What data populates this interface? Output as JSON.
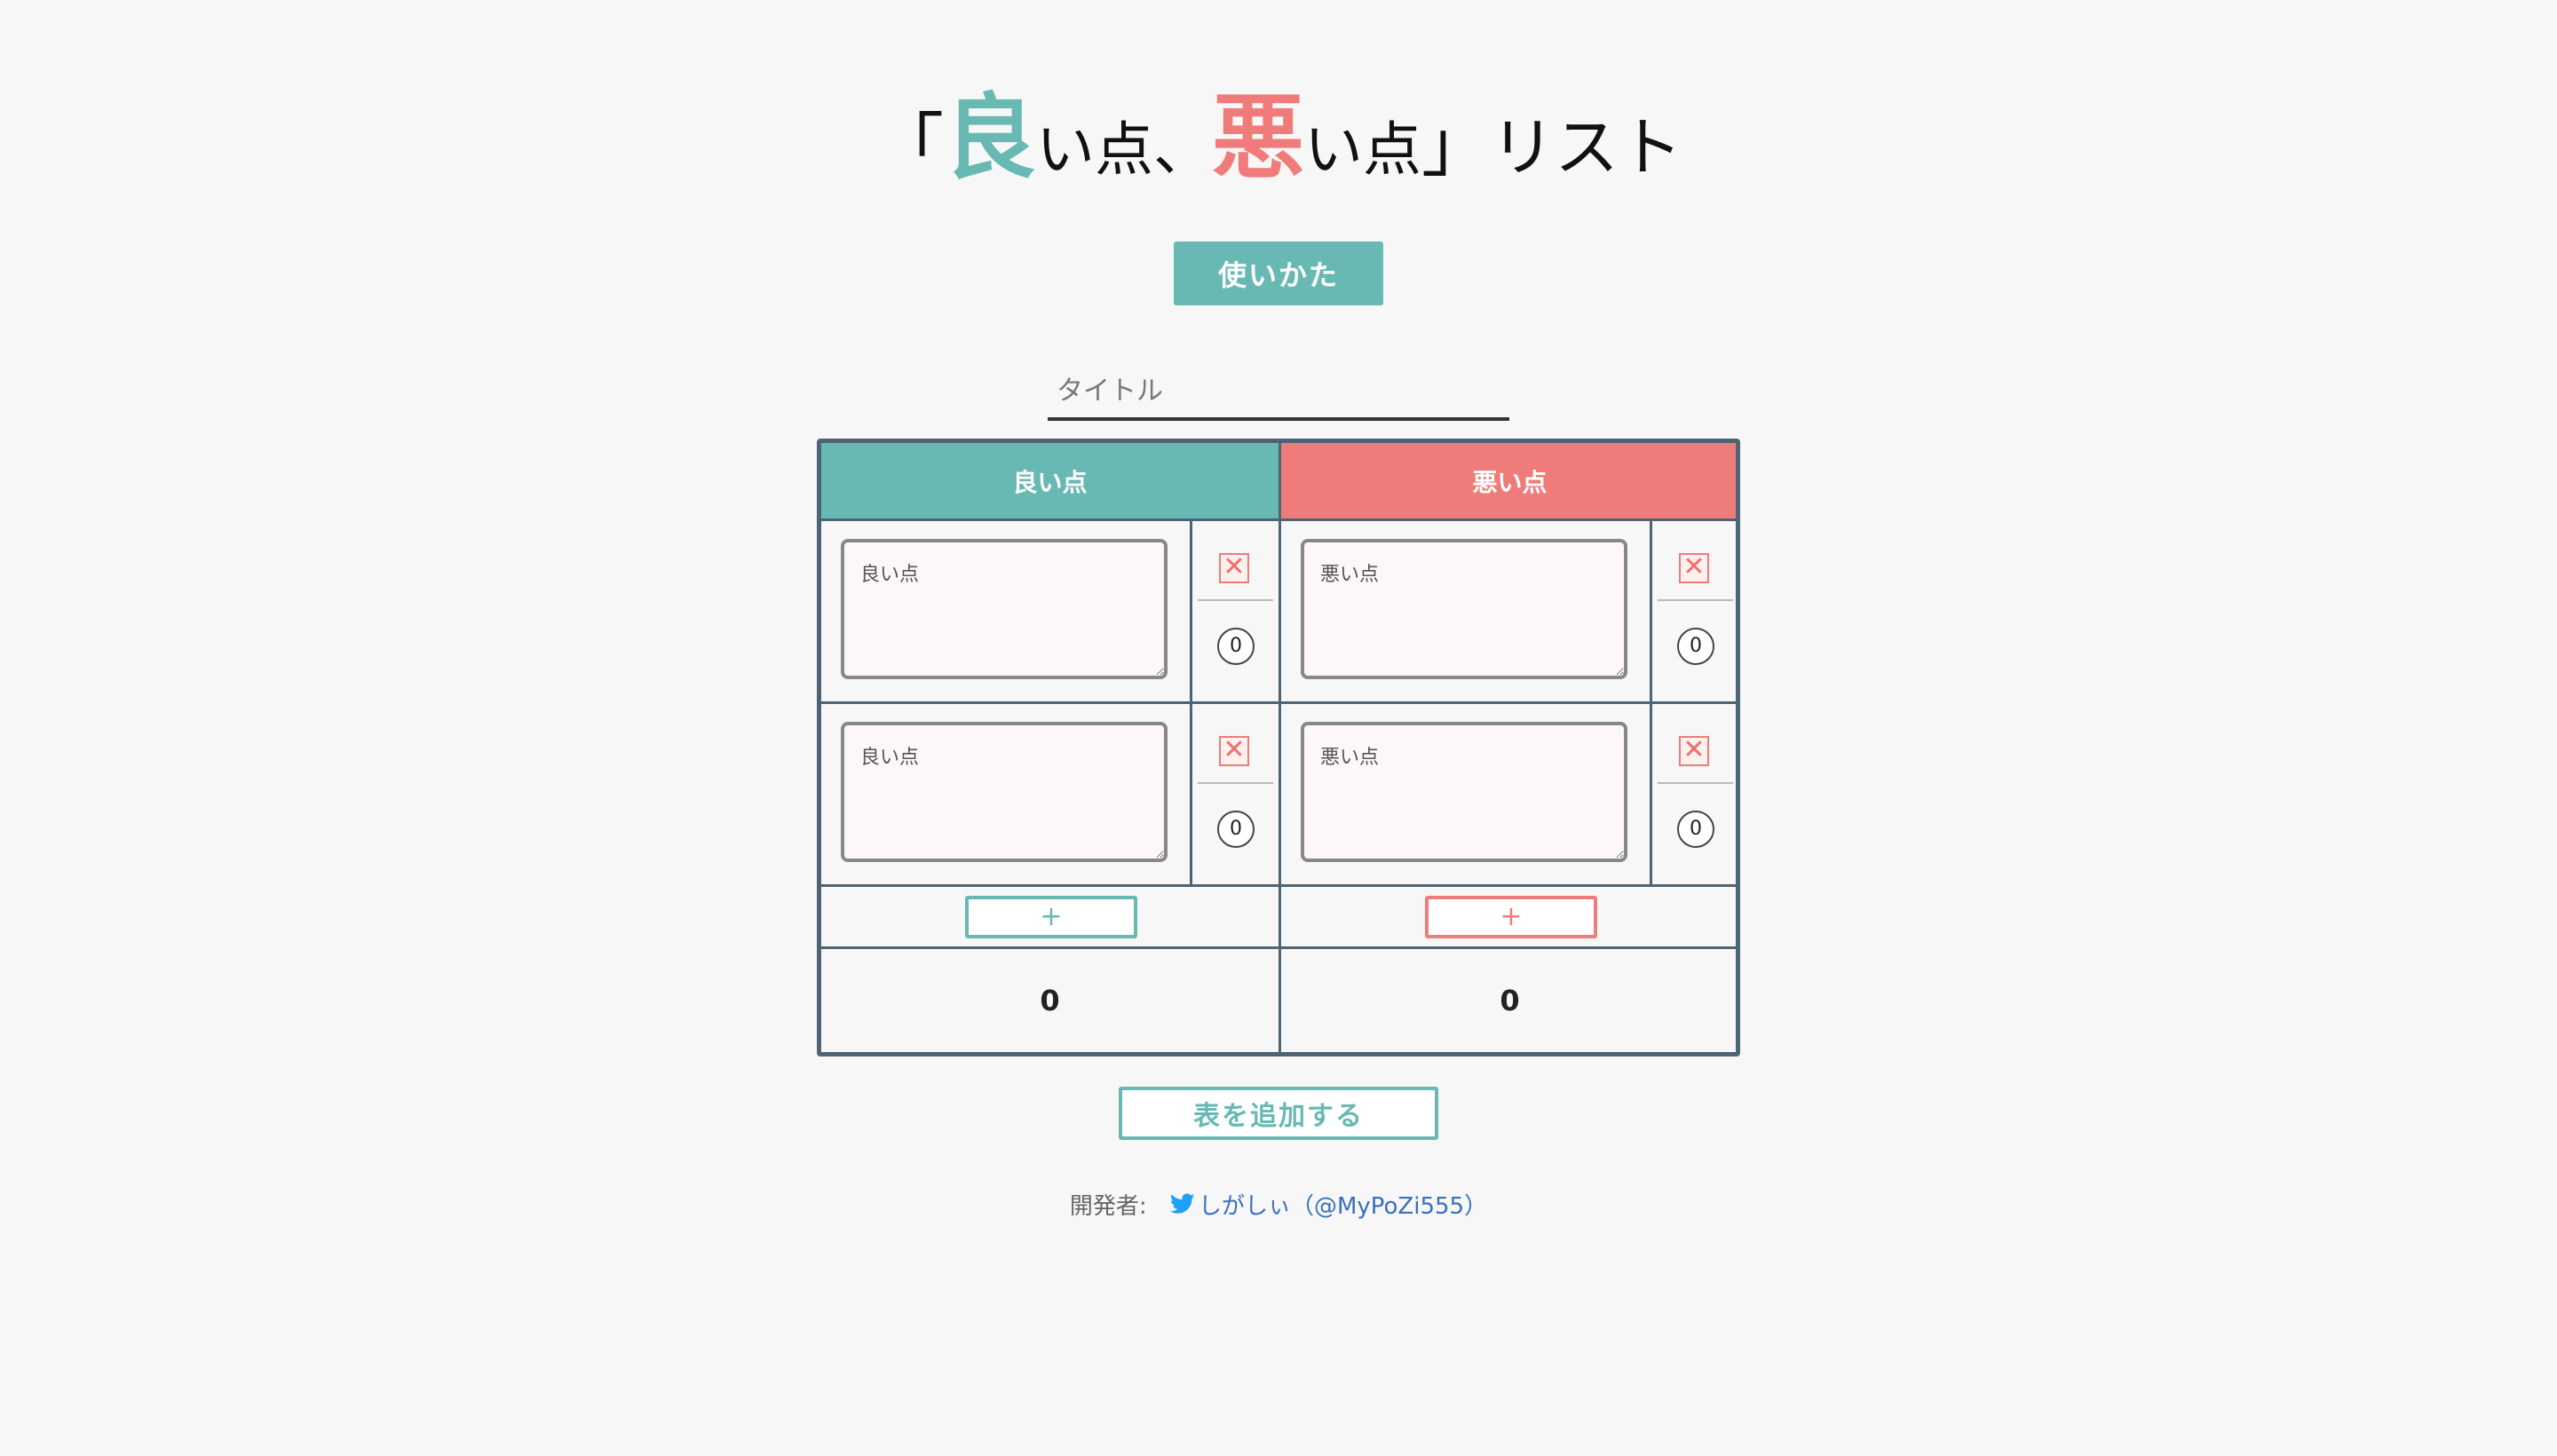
{
  "title": {
    "open_bracket": "「",
    "good_char": "良",
    "good_rest": "い点、",
    "bad_char": "悪",
    "bad_rest": "い点",
    "close_bracket": "」",
    "suffix": "リスト"
  },
  "howto_label": "使いかた",
  "title_input": {
    "placeholder": "タイトル",
    "value": ""
  },
  "columns": {
    "good": {
      "header": "良い点",
      "rows": [
        {
          "placeholder": "良い点",
          "delete": "✕",
          "count": "0"
        },
        {
          "placeholder": "良い点",
          "delete": "✕",
          "count": "0"
        }
      ],
      "add_label": "+",
      "total": "0"
    },
    "bad": {
      "header": "悪い点",
      "rows": [
        {
          "placeholder": "悪い点",
          "delete": "✕",
          "count": "0"
        },
        {
          "placeholder": "悪い点",
          "delete": "✕",
          "count": "0"
        }
      ],
      "add_label": "+",
      "total": "0"
    }
  },
  "add_table_label": "表を追加する",
  "footer": {
    "label": "開発者:",
    "icon": "twitter-bird-icon",
    "link_text": "しがしぃ（@MyPoZi555）"
  },
  "colors": {
    "good": "#68b9b3",
    "bad": "#ef7c7a",
    "border": "#4d6475",
    "link": "#3a6fbf"
  }
}
